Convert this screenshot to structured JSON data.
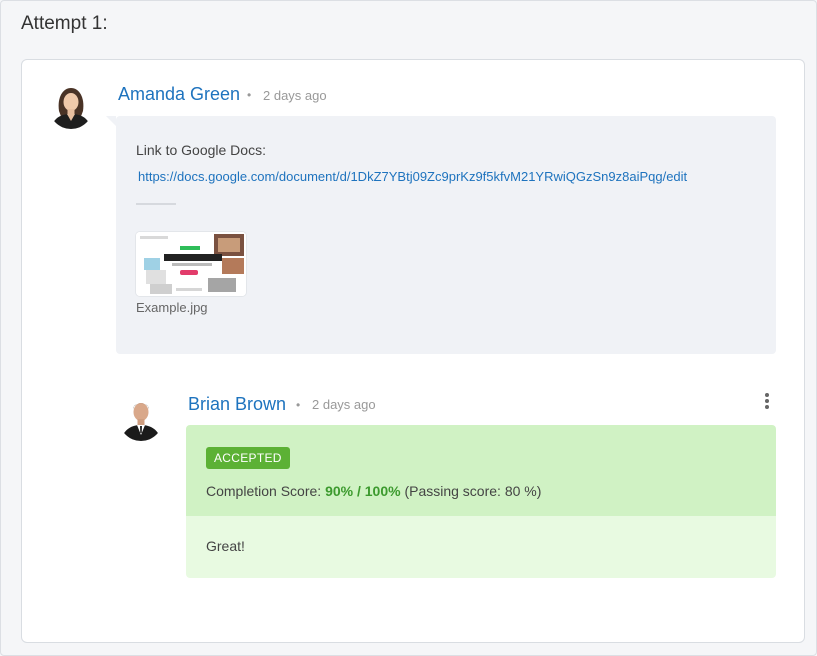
{
  "attempt": {
    "title": "Attempt 1:"
  },
  "submission": {
    "author": "Amanda Green",
    "separator": "•",
    "time": "2 days ago",
    "link_label": "Link to Google Docs:",
    "link_url": "https://docs.google.com/document/d/1DkZ7YBtj09Zc9prKz9f5kfvM21YRwiQGzSn9z8aiPqg/edit",
    "attachment": {
      "file_name": "Example.jpg"
    }
  },
  "review": {
    "author": "Brian Brown",
    "separator": "•",
    "time": "2 days ago",
    "status_badge": "ACCEPTED",
    "score_prefix": "Completion Score:",
    "score_value": "90% / 100%",
    "passing_text": "(Passing score: 80 %)",
    "comment": "Great!",
    "menu_icon": "more-vertical-icon"
  },
  "colors": {
    "link": "#1e73be",
    "accepted_badge": "#5cb135",
    "score": "#3c9a2e",
    "review_header_bg": "#d0f2c4",
    "review_body_bg": "#e8fae1"
  }
}
